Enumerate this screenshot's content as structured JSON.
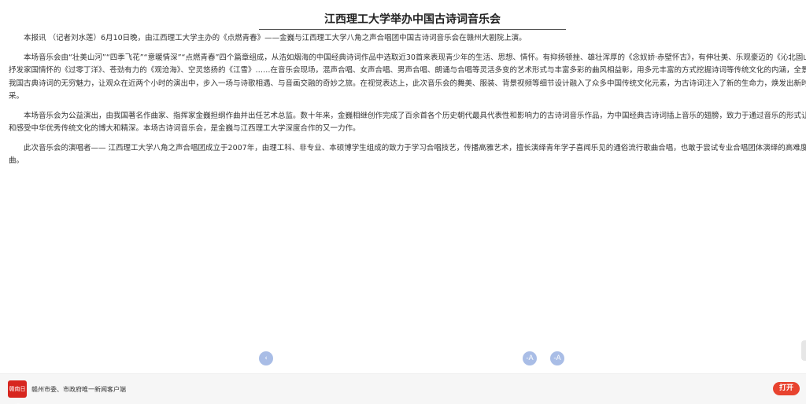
{
  "article": {
    "title": "江西理工大学举办中国古诗词音乐会",
    "paragraphs": [
      "本报讯 （记者刘水莲）6月10日晚，由江西理工大学主办的《点燃青春》——金巍与江西理工大学八角之声合唱团中国古诗词音乐会在赣州大剧院上演。",
      "本场音乐会由“壮美山河”“四季飞花”“意暖情深”“点燃青春”四个篇章组成，从浩如烟海的中国经典诗词作品中选取近30首来表现青少年的生活、思想、情怀。有抑扬顿挫、雄壮浑厚的《念奴娇·赤壁怀古》，有伸壮美、乐观豪迈的《沁北固山下》，有抒发家国情怀的《过零丁洋》、苍劲有力的《观沧海》、空灵悠扬的《江雪》……在音乐会现场，混声合唱、女声合唱、男声合唱、朗诵与合唱等灵活多变的艺术形式与丰富多彩的曲风相益彰，用多元丰富的方式挖掘诗词等传统文化的内涵，全景式地展现我国古典诗词的无穷魅力，让观众在近两个小时的演出中，步入一场与诗歌相遇、与音画交融的奇妙之旅。在视觉表达上，此次音乐会的舞美、服装、背景视频等细节设计融入了众多中国传统文化元素，为古诗词注入了新的生命力，焕发出新时代的风采。",
      "本场音乐会为公益演出，由我国著名作曲家、指挥家金巍担纲作曲并出任艺术总监。数十年来，金巍相继创作完成了百余首各个历史朝代最具代表性和影响力的古诗词音乐作品，为中国经典古诗词插上音乐的翅膀，致力于通过音乐的形式让观众领略和感受中华优秀传统文化的博大和精深。本场古诗词音乐会，是金巍与江西理工大学深度合作的又一力作。",
      "此次音乐会的演唱者—— 江西理工大学八角之声合唱团成立于2007年，由理工科、非专业、本硕博学生组成的致力于学习合唱技艺，传播高雅艺术，擅长演绎青年学子喜闻乐见的通俗流行歌曲合唱，也敢于尝试专业合唱团体演绎的高难度艺术歌曲。"
    ]
  },
  "controls": {
    "prev_symbol": "‹",
    "font_smaller": "-A",
    "font_larger": "-A"
  },
  "footer": {
    "logo_text": "赣南日报",
    "text": "赣州市委、市政府唯一新闻客户端",
    "open_label": "打开"
  },
  "colors": {
    "control_bg": "#a9bde6",
    "open_button": "#e8432f",
    "logo_red": "#d7261f"
  }
}
